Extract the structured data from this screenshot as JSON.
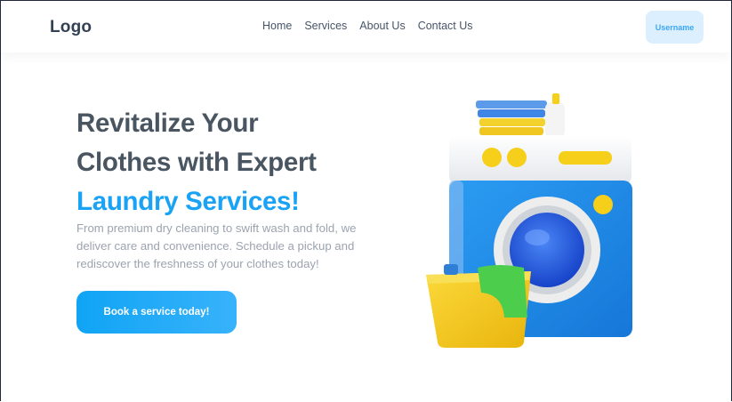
{
  "header": {
    "logo": "Logo",
    "nav": [
      "Home",
      "Services",
      "About Us",
      "Contact Us"
    ],
    "username_button": "Username"
  },
  "hero": {
    "title_line1": "Revitalize Your",
    "title_line2": "Clothes with Expert",
    "title_accent": "Laundry Services!",
    "description": "From premium dry cleaning to swift wash and fold, we deliver care and convenience. Schedule a pickup and rediscover the freshness of your clothes today!",
    "cta_label": "Book a service today!"
  },
  "illustration": {
    "icon": "washing-machine-icon",
    "colors": {
      "body": "#1e8fe8",
      "top": "#f1f1f1",
      "accent_yellow": "#f6cf1a",
      "towel_green": "#4ccd4c"
    }
  },
  "colors": {
    "accent": "#1aa3f5",
    "heading": "#4a5562",
    "text_muted": "#9ca3af",
    "button_light": "#dcefff"
  }
}
